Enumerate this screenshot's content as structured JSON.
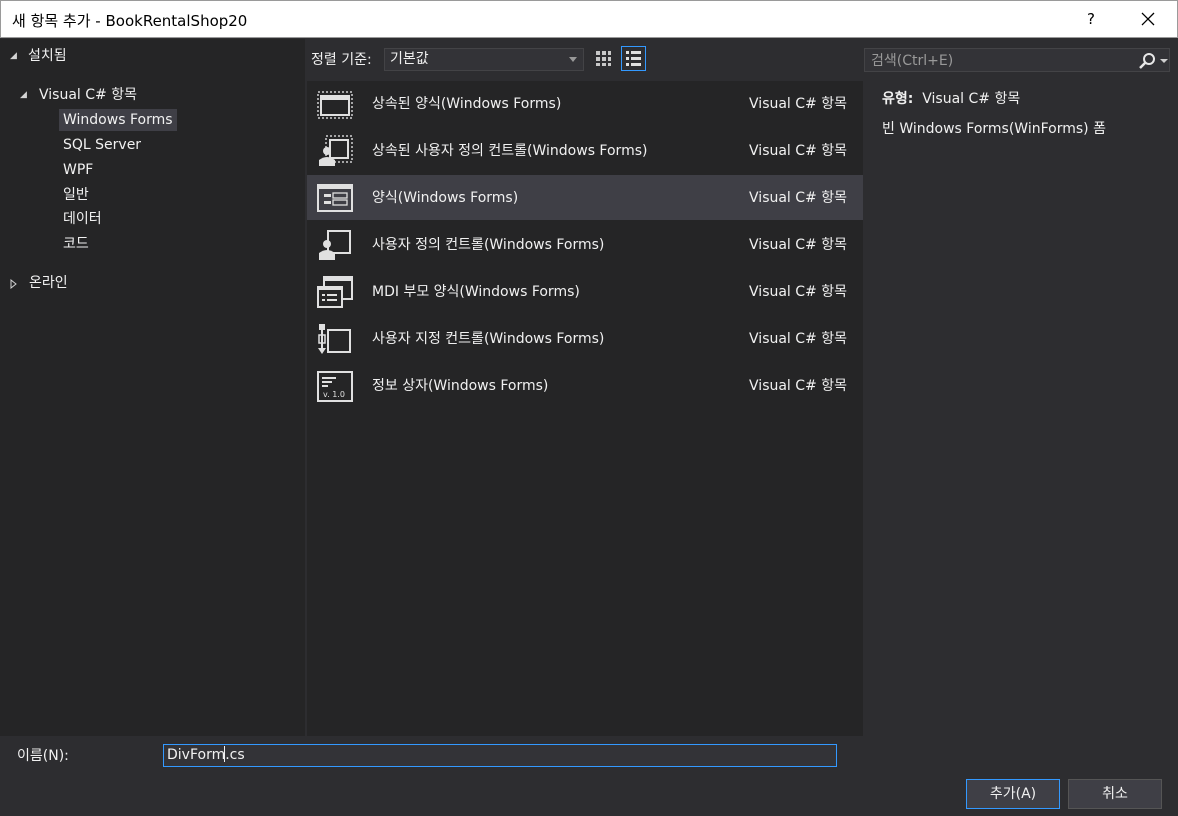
{
  "window": {
    "title": "새 항목 추가 - BookRentalShop20",
    "help_label": "?"
  },
  "tree": {
    "installed_label": "설치됨",
    "csharp_label": "Visual C# 항목",
    "children": [
      "Windows Forms",
      "SQL Server",
      "WPF",
      "일반",
      "데이터",
      "코드"
    ],
    "selected_child": "Windows Forms",
    "online_label": "온라인"
  },
  "toolbar": {
    "sort_label": "정렬 기준:",
    "sort_value": "기본값"
  },
  "search": {
    "placeholder": "검색(Ctrl+E)"
  },
  "templates": [
    {
      "name": "상속된 양식(Windows Forms)",
      "type": "Visual C# 항목",
      "icon": "inherited-form-icon"
    },
    {
      "name": "상속된 사용자 정의 컨트롤(Windows Forms)",
      "type": "Visual C# 항목",
      "icon": "inherited-user-control-icon"
    },
    {
      "name": "양식(Windows Forms)",
      "type": "Visual C# 항목",
      "icon": "form-icon",
      "selected": true
    },
    {
      "name": "사용자 정의 컨트롤(Windows Forms)",
      "type": "Visual C# 항목",
      "icon": "user-control-icon"
    },
    {
      "name": "MDI 부모 양식(Windows Forms)",
      "type": "Visual C# 항목",
      "icon": "mdi-parent-form-icon"
    },
    {
      "name": "사용자 지정 컨트롤(Windows Forms)",
      "type": "Visual C# 항목",
      "icon": "custom-control-icon"
    },
    {
      "name": "정보 상자(Windows Forms)",
      "type": "Visual C# 항목",
      "icon": "about-box-icon",
      "version_text": "v. 1.0"
    }
  ],
  "details": {
    "type_label": "유형:",
    "type_value": "Visual C# 항목",
    "description": "빈 Windows Forms(WinForms) 폼"
  },
  "bottom": {
    "name_label": "이름(N):",
    "name_value_before_caret": "DivForm",
    "name_value_after_caret": ".cs",
    "add_button": "추가(A)",
    "cancel_button": "취소"
  },
  "colors": {
    "background": "#2d2d30",
    "panel": "#252526",
    "selection": "#3f3f46",
    "accent": "#3399ff",
    "text": "#f1f1f1"
  }
}
